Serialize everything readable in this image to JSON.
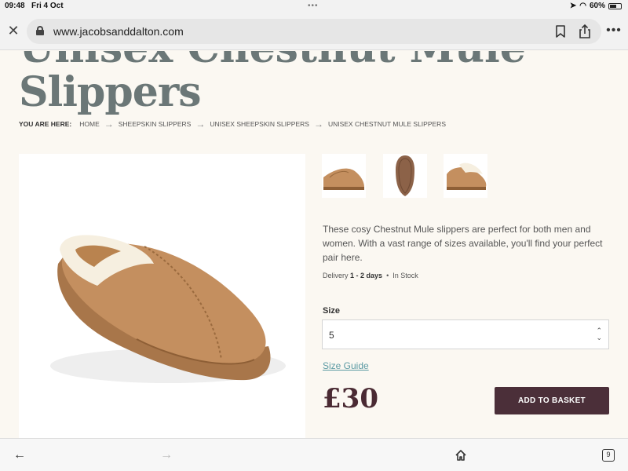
{
  "status_bar": {
    "time": "09:48",
    "date": "Fri 4 Oct",
    "battery": "60%"
  },
  "browser": {
    "url": "www.jacobsanddalton.com"
  },
  "product": {
    "title_partial": "Unisex Chestnut Mule",
    "title": "Slippers",
    "breadcrumb": {
      "lead": "YOU ARE HERE:",
      "items": [
        "HOME",
        "SHEEPSKIN SLIPPERS",
        "UNISEX SHEEPSKIN SLIPPERS",
        "UNISEX CHESTNUT MULE SLIPPERS"
      ]
    },
    "description": "These cosy Chestnut Mule slippers are perfect for both men and women. With a vast range of sizes available, you'll find your perfect pair here.",
    "delivery_label": "Delivery",
    "delivery_value": "1 - 2 days",
    "separator": "•",
    "stock": "In Stock",
    "size_label": "Size",
    "size_value": "5",
    "size_guide": "Size Guide",
    "price": "£30",
    "add_to_basket": "ADD TO BASKET"
  },
  "toolbar": {
    "tab_count": "9"
  },
  "colors": {
    "accent": "#4b2f39",
    "title": "#6b7777",
    "link": "#5b9aa3",
    "background": "#fbf8f2"
  }
}
